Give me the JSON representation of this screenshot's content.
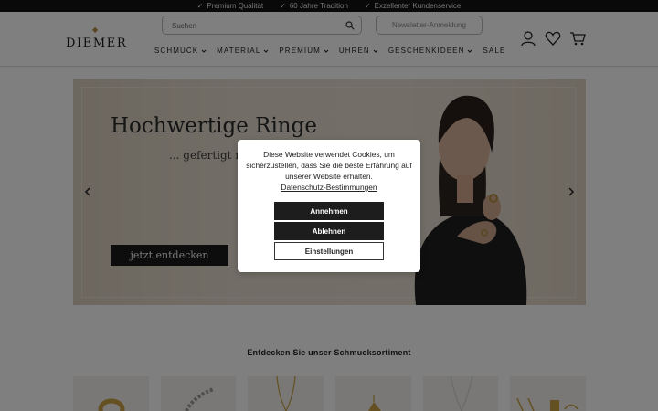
{
  "topbar": {
    "usps": [
      "Premium Qualität",
      "60 Jahre Tradition",
      "Exzellenter Kundenservice"
    ]
  },
  "header": {
    "logo": "DIEMER",
    "search": {
      "placeholder": "Suchen"
    },
    "newsletter_label": "Newsletter-Anmeldung",
    "icons": [
      "user-icon",
      "heart-icon",
      "cart-icon"
    ],
    "nav": [
      "SCHMUCK",
      "MATERIAL",
      "PREMIUM",
      "UHREN",
      "GESCHENKIDEEN",
      "SALE"
    ]
  },
  "hero": {
    "title": "Hochwertige Ringe",
    "subtitle": "... gefertigt m",
    "cta": "jetzt entdecken"
  },
  "section": {
    "title": "Entdecken Sie unser Schmucksortiment"
  },
  "cookie_dialog": {
    "text": "Diese Website verwendet Cookies, um sicherzustellen, dass Sie die beste Erfahrung auf unserer Website erhalten.",
    "privacy_link": "Datenschutz-Bestimmungen",
    "accept": "Annehmen",
    "decline": "Ablehnen",
    "settings": "Einstellungen"
  },
  "colors": {
    "topbar": "#121212",
    "hero_bg": "#e1d7c8",
    "button_dark": "#1d1d1d",
    "logo_accent": "#b08a42"
  }
}
